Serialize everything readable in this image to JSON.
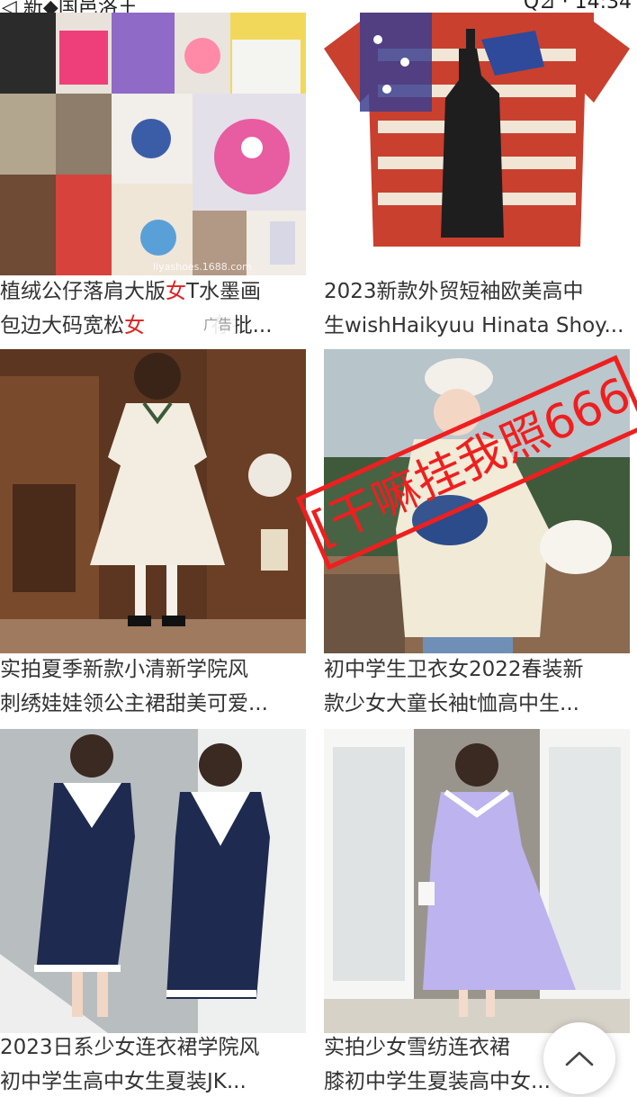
{
  "status_bar": {
    "left_fragment": "◁ 新◆国邑洛王",
    "right_fragment": "Q⊿ · 14:34"
  },
  "products": [
    {
      "title_parts": [
        "植绒公仔落肩大版",
        "女",
        "T水墨画"
      ],
      "title_line2_parts": [
        "包边大码宽松",
        "女",
        " 存批..."
      ],
      "ad_label": "广告"
    },
    {
      "title_line1": "2023新款外贸短袖欧美高中",
      "title_line2": "生wishHaikyuu Hinata Shoy..."
    },
    {
      "title_line1": "实拍夏季新款小清新学院风",
      "title_line2": "刺绣娃娃领公主裙甜美可爱..."
    },
    {
      "title_line1": "初中学生卫衣女2022春装新",
      "title_line2": "款少女大童长袖t恤高中生...",
      "watermark": "[干嘛挂我照666]"
    },
    {
      "title_line1": "2023日系少女连衣裙学院风",
      "title_line2": "初中学生高中女生夏装JK..."
    },
    {
      "title_line1": "实拍少女雪纺连衣裙",
      "title_line2": "膝初中学生夏装高中女..."
    }
  ],
  "collage_text": "liyashoes.1688.com",
  "colors": {
    "accent_red": "#e02020",
    "watermark_red": "#ef1f1f"
  },
  "icons": {
    "back_to_top": "chevron-up-icon"
  }
}
